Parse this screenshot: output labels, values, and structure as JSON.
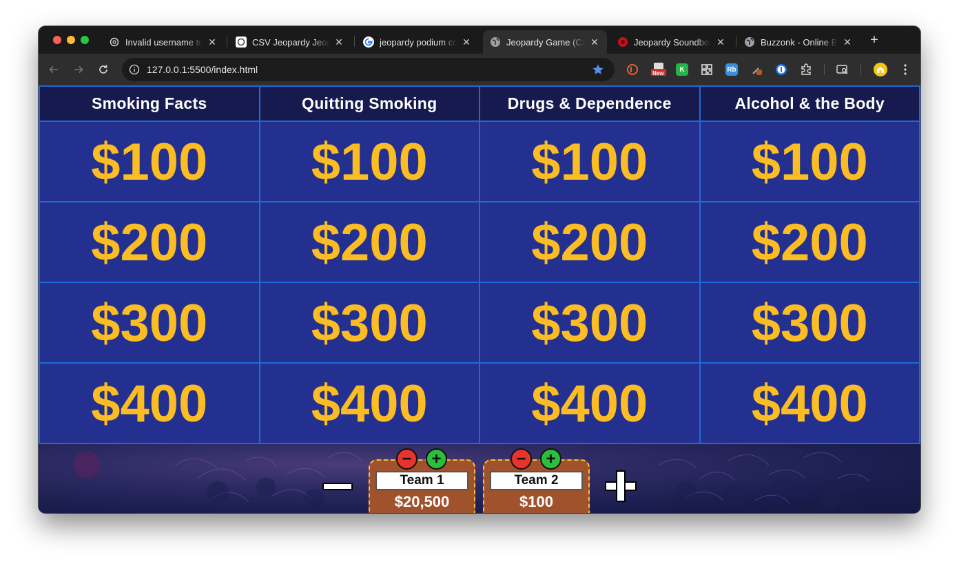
{
  "browser": {
    "tabs": [
      {
        "title": "Invalid username tok",
        "icon": "openai-icon"
      },
      {
        "title": "CSV Jeopardy Jeopardy",
        "icon": "openai-icon"
      },
      {
        "title": "jeopardy podium co",
        "icon": "google-icon"
      },
      {
        "title": "Jeopardy Game (CSV",
        "icon": "globe-icon",
        "active": true
      },
      {
        "title": "Jeopardy Soundboa",
        "icon": "soundboard-icon"
      },
      {
        "title": "Buzzonk - Online Bu",
        "icon": "globe-icon"
      }
    ],
    "new_tab_label": "+",
    "close_label": "✕",
    "url": "127.0.0.1:5500/index.html",
    "extensions": [
      {
        "name": "honey-extension-icon",
        "label": ""
      },
      {
        "name": "new-badge-extension-icon",
        "label": "New"
      },
      {
        "name": "k-extension-icon",
        "label": "K"
      },
      {
        "name": "qr-extension-icon",
        "label": ""
      },
      {
        "name": "rb-extension-icon",
        "label": "Rb"
      },
      {
        "name": "eyedropper-extension-icon",
        "label": ""
      },
      {
        "name": "onepassword-extension-icon",
        "label": ""
      },
      {
        "name": "puzzle-extensions-icon",
        "label": ""
      }
    ]
  },
  "board": {
    "categories": [
      "Smoking Facts",
      "Quitting Smoking",
      "Drugs & Dependence",
      "Alcohol & the Body"
    ],
    "values": [
      "$100",
      "$200",
      "$300",
      "$400"
    ]
  },
  "controls": {
    "remove_team_label": "−",
    "add_team_label": "+"
  },
  "teams": [
    {
      "name": "Team 1",
      "score": "$20,500",
      "minus": "−",
      "plus": "+"
    },
    {
      "name": "Team 2",
      "score": "$100",
      "minus": "−",
      "plus": "+"
    }
  ],
  "colors": {
    "cell_bg": "#24308f",
    "money": "#fbbd23",
    "grid_line": "#1f6ad6",
    "podium": "#a0522d",
    "podium_border": "#f5c23a"
  }
}
